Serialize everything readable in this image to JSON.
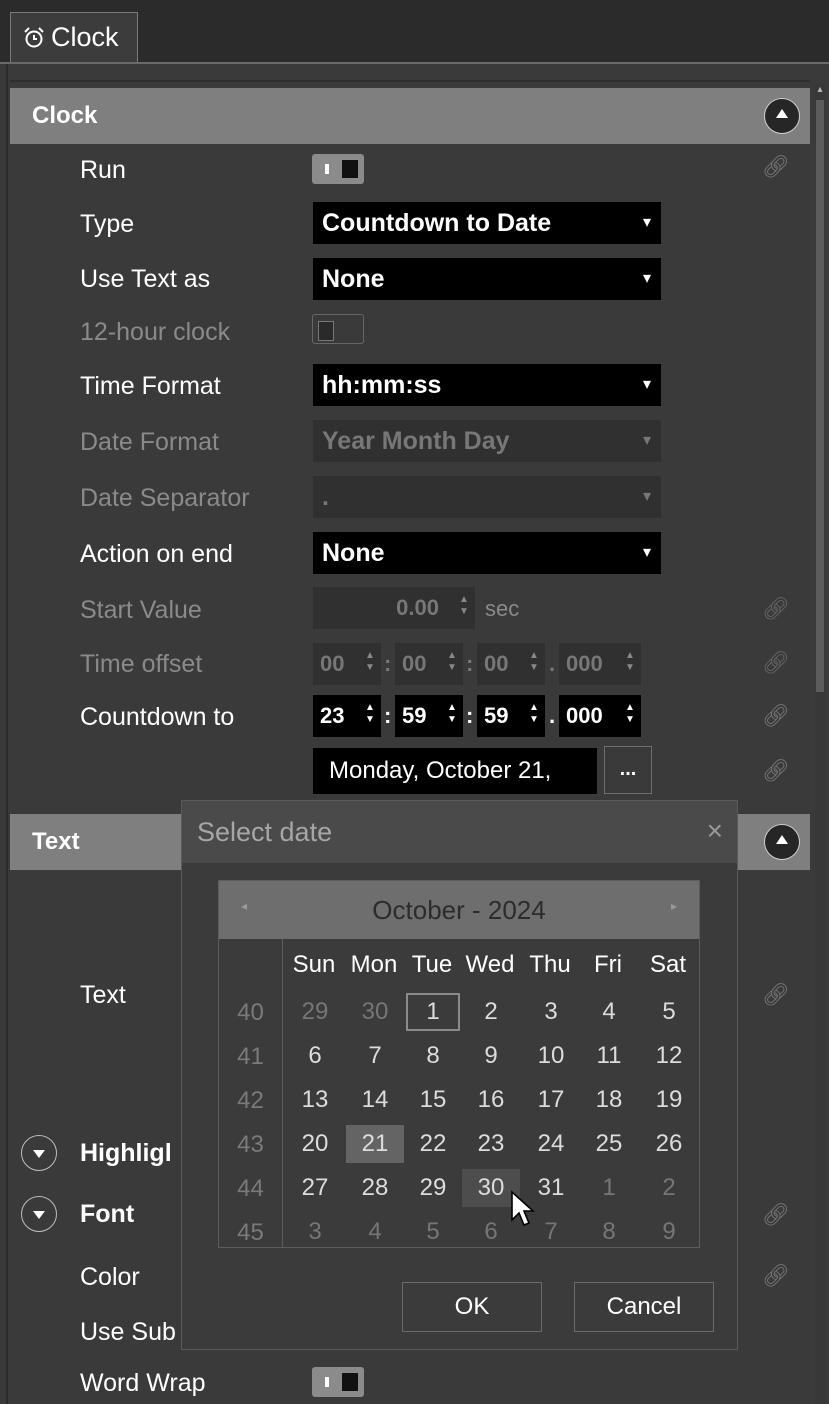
{
  "tab": {
    "label": "Clock",
    "icon": "alarm-clock-icon"
  },
  "sections": {
    "clock": "Clock",
    "text": "Text"
  },
  "rows": {
    "run": "Run",
    "type": "Type",
    "type_value": "Countdown to Date",
    "use_text_as": "Use Text as",
    "use_text_as_value": "None",
    "twelve_hour": "12-hour clock",
    "time_format": "Time Format",
    "time_format_value": "hh:mm:ss",
    "date_format": "Date Format",
    "date_format_value": "Year Month Day",
    "date_separator": "Date Separator",
    "date_separator_value": ".",
    "action_on_end": "Action on end",
    "action_on_end_value": "None",
    "start_value": "Start Value",
    "start_value_num": "0.00",
    "start_value_unit": "sec",
    "time_offset": "Time offset",
    "time_offset_values": [
      "00",
      "00",
      "00",
      "000"
    ],
    "countdown_to": "Countdown to",
    "countdown_values": [
      "23",
      "59",
      "59",
      "000"
    ],
    "countdown_date": "Monday, October 21,",
    "ellipsis": "...",
    "text": "Text",
    "highlight": "Highligl",
    "font": "Font",
    "color": "Color",
    "use_sub": "Use Sub",
    "word_wrap": "Word Wrap"
  },
  "separators": {
    "colon": ":",
    "dot": "."
  },
  "dialog": {
    "title": "Select date",
    "close": "×",
    "month_label": "October - 2024",
    "prev": "◂",
    "next": "▸",
    "days_of_week": [
      "Sun",
      "Mon",
      "Tue",
      "Wed",
      "Thu",
      "Fri",
      "Sat"
    ],
    "weeks": [
      {
        "num": "40",
        "days": [
          "29",
          "30",
          "1",
          "2",
          "3",
          "4",
          "5"
        ]
      },
      {
        "num": "41",
        "days": [
          "6",
          "7",
          "8",
          "9",
          "10",
          "11",
          "12"
        ]
      },
      {
        "num": "42",
        "days": [
          "13",
          "14",
          "15",
          "16",
          "17",
          "18",
          "19"
        ]
      },
      {
        "num": "43",
        "days": [
          "20",
          "21",
          "22",
          "23",
          "24",
          "25",
          "26"
        ]
      },
      {
        "num": "44",
        "days": [
          "27",
          "28",
          "29",
          "30",
          "31",
          "1",
          "2"
        ]
      },
      {
        "num": "45",
        "days": [
          "3",
          "4",
          "5",
          "6",
          "7",
          "8",
          "9"
        ]
      }
    ],
    "ok": "OK",
    "cancel": "Cancel"
  },
  "colors": {
    "panel": "#3a3a3a",
    "section_header": "#7f7f7f",
    "combo_bg": "#000000",
    "selected_day": "#646464"
  }
}
